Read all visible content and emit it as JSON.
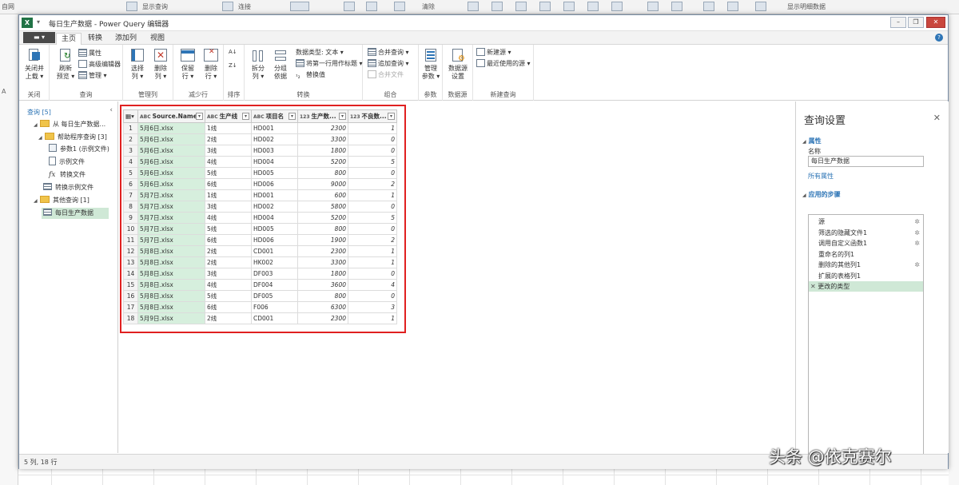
{
  "excel_bg": {
    "ribbon_fragments": [
      "自网",
      "显示查询",
      "连接",
      "清除",
      "显示明细数据"
    ],
    "column_a": "A"
  },
  "window": {
    "title": "每日生产数据 - Power Query 编辑器",
    "file_button": "▬ ▾",
    "quick_access": "▾"
  },
  "tabs": [
    "主页",
    "转换",
    "添加列",
    "视图"
  ],
  "ribbon": {
    "groups": {
      "close": "关闭",
      "query": "查询",
      "manage_cols": "管理列",
      "reduce_rows": "减少行",
      "sort": "排序",
      "transform": "转换",
      "combine": "组合",
      "params": "参数",
      "datasource": "数据源",
      "newquery": "新建查询"
    },
    "buttons": {
      "close_load_1": "关闭并",
      "close_load_2": "上载 ▾",
      "refresh_1": "刷新",
      "refresh_2": "预览 ▾",
      "properties": "属性",
      "advanced_editor": "高级编辑器",
      "manage": "管理 ▾",
      "choose_cols_1": "选择",
      "choose_cols_2": "列 ▾",
      "remove_cols_1": "删除",
      "remove_cols_2": "列 ▾",
      "keep_rows_1": "保留",
      "keep_rows_2": "行 ▾",
      "remove_rows_1": "删除",
      "remove_rows_2": "行 ▾",
      "split_1": "拆分",
      "split_2": "列 ▾",
      "groupby_1": "分组",
      "groupby_2": "依据",
      "datatype": "数据类型: 文本 ▾",
      "first_row_header": "将第一行用作标题 ▾",
      "replace_values": "替换值",
      "merge_queries": "合并查询 ▾",
      "append_queries": "追加查询 ▾",
      "combine_files": "合并文件",
      "manage_params_1": "管理",
      "manage_params_2": "参数 ▾",
      "ds_settings_1": "数据源",
      "ds_settings_2": "设置",
      "new_source": "新建源 ▾",
      "recent_sources": "最近使用的源 ▾"
    }
  },
  "query_pane": {
    "header": "查询 [5]",
    "items": [
      {
        "label": "从 每日生产数据..."
      },
      {
        "label": "帮助程序查询 [3]"
      },
      {
        "label": "参数1 (示例文件)"
      },
      {
        "label": "示例文件"
      },
      {
        "label": "转换文件"
      },
      {
        "label": "转换示例文件"
      },
      {
        "label": "其他查询 [1]"
      },
      {
        "label": "每日生产数据"
      }
    ]
  },
  "grid": {
    "columns": [
      {
        "type": "ABC",
        "name": "Source.Name"
      },
      {
        "type": "ABC",
        "name": "生产线"
      },
      {
        "type": "ABC",
        "name": "项目名"
      },
      {
        "type": "123",
        "name": "生产数..."
      },
      {
        "type": "123",
        "name": "不良数..."
      }
    ],
    "rows": [
      [
        "1",
        "5月6日.xlsx",
        "1线",
        "HD001",
        "2300",
        "1"
      ],
      [
        "2",
        "5月6日.xlsx",
        "2线",
        "HD002",
        "3300",
        "0"
      ],
      [
        "3",
        "5月6日.xlsx",
        "3线",
        "HD003",
        "1800",
        "0"
      ],
      [
        "4",
        "5月6日.xlsx",
        "4线",
        "HD004",
        "5200",
        "5"
      ],
      [
        "5",
        "5月6日.xlsx",
        "5线",
        "HD005",
        "800",
        "0"
      ],
      [
        "6",
        "5月6日.xlsx",
        "6线",
        "HD006",
        "9000",
        "2"
      ],
      [
        "7",
        "5月7日.xlsx",
        "1线",
        "HD001",
        "600",
        "1"
      ],
      [
        "8",
        "5月7日.xlsx",
        "3线",
        "HD002",
        "5800",
        "0"
      ],
      [
        "9",
        "5月7日.xlsx",
        "4线",
        "HD004",
        "5200",
        "5"
      ],
      [
        "10",
        "5月7日.xlsx",
        "5线",
        "HD005",
        "800",
        "0"
      ],
      [
        "11",
        "5月7日.xlsx",
        "6线",
        "HD006",
        "1900",
        "2"
      ],
      [
        "12",
        "5月8日.xlsx",
        "2线",
        "CD001",
        "2300",
        "1"
      ],
      [
        "13",
        "5月8日.xlsx",
        "2线",
        "HK002",
        "3300",
        "1"
      ],
      [
        "14",
        "5月8日.xlsx",
        "3线",
        "DF003",
        "1800",
        "0"
      ],
      [
        "15",
        "5月8日.xlsx",
        "4线",
        "DF004",
        "3600",
        "4"
      ],
      [
        "16",
        "5月8日.xlsx",
        "5线",
        "DF005",
        "800",
        "0"
      ],
      [
        "17",
        "5月8日.xlsx",
        "6线",
        "F006",
        "6300",
        "3"
      ],
      [
        "18",
        "5月9日.xlsx",
        "2线",
        "CD001",
        "2300",
        "1"
      ]
    ]
  },
  "settings_pane": {
    "title": "查询设置",
    "props_header": "属性",
    "name_label": "名称",
    "name_value": "每日生产数据",
    "all_props": "所有属性",
    "steps_header": "应用的步骤",
    "steps": [
      {
        "label": "源",
        "gear": true
      },
      {
        "label": "筛选的隐藏文件1",
        "gear": true
      },
      {
        "label": "调用自定义函数1",
        "gear": true
      },
      {
        "label": "重命名的列1",
        "gear": false
      },
      {
        "label": "删除的其他列1",
        "gear": true
      },
      {
        "label": "扩展的表格列1",
        "gear": false
      },
      {
        "label": "更改的类型",
        "gear": false,
        "active": true
      }
    ]
  },
  "status": "5 列, 18 行",
  "watermark": "头条 @依克赛尔",
  "colors": {
    "accent": "#2e75b6",
    "excel_green": "#217346",
    "highlight_red": "#e02020",
    "selected_green": "#cfe8d6"
  }
}
